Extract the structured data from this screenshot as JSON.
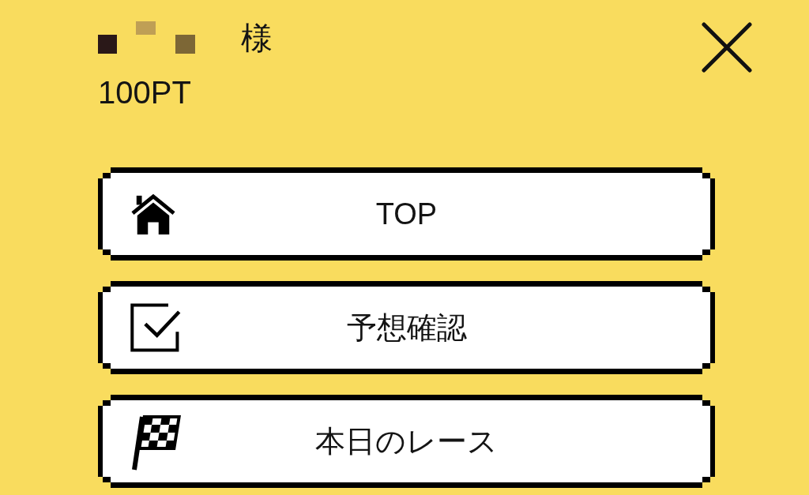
{
  "user": {
    "honorific": "様",
    "points": "100PT"
  },
  "menu": [
    {
      "kind": "home",
      "label": "TOP"
    },
    {
      "kind": "check",
      "label": "予想確認"
    },
    {
      "kind": "flag",
      "label": "本日のレース"
    }
  ]
}
